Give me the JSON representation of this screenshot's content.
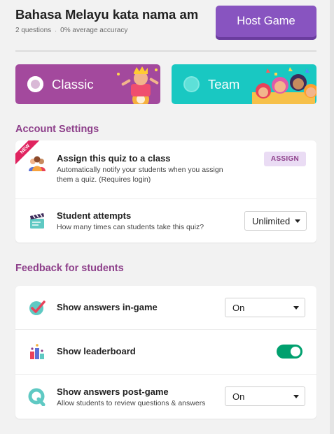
{
  "header": {
    "quiz_title": "Bahasa Melayu kata nama am",
    "question_count": "2 questions",
    "separator": "·",
    "accuracy": "0% average accuracy",
    "host_button": "Host Game"
  },
  "modes": {
    "classic": {
      "label": "Classic",
      "selected": true
    },
    "team": {
      "label": "Team",
      "selected": false
    }
  },
  "account_settings": {
    "title": "Account Settings",
    "assign": {
      "badge": "NEW",
      "title": "Assign this quiz to a class",
      "desc_line1": "Automatically notify your students when you assign",
      "desc_line2": "them a quiz. (Requires login)",
      "button": "ASSIGN"
    },
    "attempts": {
      "title": "Student attempts",
      "desc": "How many times can students take this quiz?",
      "value": "Unlimited"
    }
  },
  "feedback": {
    "title": "Feedback for students",
    "answers_ingame": {
      "title": "Show answers in-game",
      "value": "On"
    },
    "leaderboard": {
      "title": "Show leaderboard",
      "enabled": true
    },
    "answers_postgame": {
      "title": "Show answers post-game",
      "desc": "Allow students to review questions & answers",
      "value": "On"
    }
  },
  "colors": {
    "purple": "#8854c0",
    "classic_bg": "#a3499d",
    "team_bg": "#19c8c2",
    "section_title": "#8d3f8a",
    "toggle_on": "#00a06e",
    "new_ribbon": "#e0235f"
  }
}
